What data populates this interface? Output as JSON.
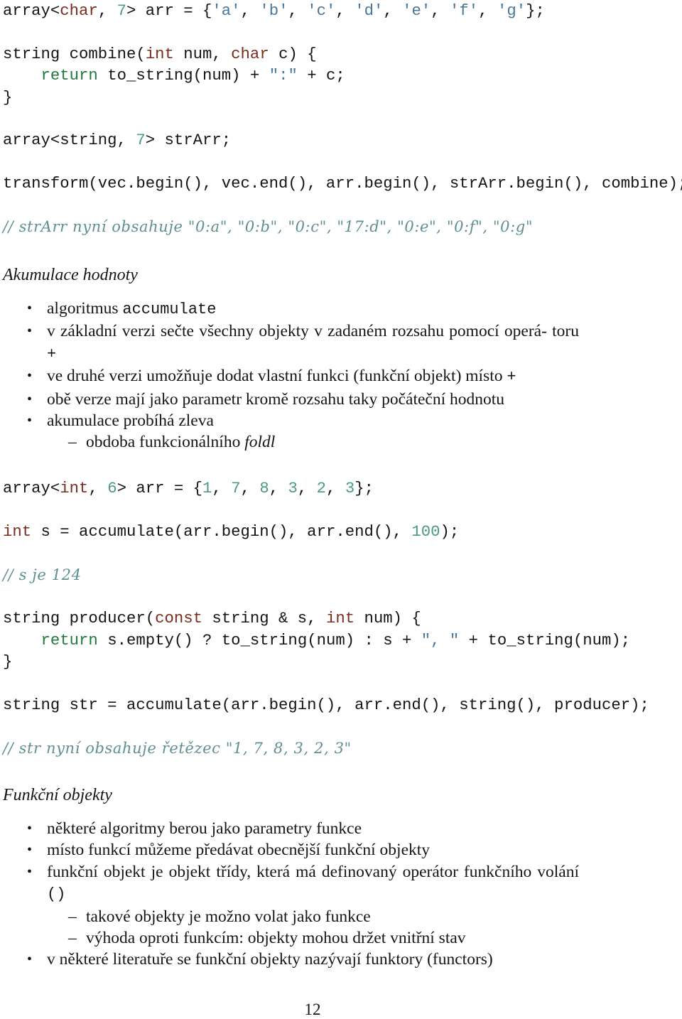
{
  "colors": {
    "type_keyword": "#7b2c1e",
    "return_keyword": "#1e7a3c",
    "number_literal": "#4c9a83",
    "string_literal": "#4a7798",
    "comment": "#5f8f90",
    "text": "#151515"
  },
  "code_block_1": {
    "line1": {
      "a": "array<",
      "t": "char",
      "b": ", ",
      "n": "7",
      "c": "> arr = {",
      "s1": "'a'",
      "s2": "'b'",
      "s3": "'c'",
      "s4": "'d'",
      "s5": "'e'",
      "s6": "'f'",
      "s7": "'g'",
      "sep": ", ",
      "end": "};"
    },
    "line2": {
      "a": "string combine(",
      "t1": "int",
      "b": " num, ",
      "t2": "char",
      "c": " c) {"
    },
    "line3": {
      "indent": "    ",
      "ret": "return",
      "a": " to_string(num) + ",
      "s": "\":\"",
      "b": " + c;"
    },
    "line4": "}",
    "line5": {
      "a": "array<string, ",
      "n": "7",
      "b": "> strArr;"
    },
    "line6": "transform(vec.begin(), vec.end(), arr.begin(), strArr.begin(), combine);",
    "comment": "// strArr nyní obsahuje \"0:a\", \"0:b\", \"0:c\", \"17:d\", \"0:e\", \"0:f\", \"0:g\""
  },
  "section_accumulate": {
    "heading": "Akumulace hodnoty",
    "items": [
      {
        "text": "algoritmus ",
        "code": "accumulate"
      },
      {
        "text": "v základní verzi sečte všechny objekty v zadaném rozsahu pomocí operá- toru ",
        "code": "+"
      },
      {
        "text": "ve druhé verzi umožňuje dodat vlastní funkci (funkční objekt) místo ",
        "code": "+"
      },
      {
        "text": "obě verze mají jako parametr kromě rozsahu taky počáteční hodnotu"
      },
      {
        "text": "akumulace probíhá zleva"
      }
    ],
    "subitem": {
      "text": "obdoba funkcionálního ",
      "italic": "foldl"
    }
  },
  "code_block_2": {
    "line1": {
      "a": "array<",
      "t": "int",
      "b": ", ",
      "n": "6",
      "c": "> arr = {",
      "v": [
        "1",
        "7",
        "8",
        "3",
        "2",
        "3"
      ],
      "sep": ", ",
      "end": "};"
    },
    "line2": {
      "t": "int",
      "a": " s = accumulate(arr.begin(), arr.end(), ",
      "n": "100",
      "b": ");"
    },
    "comment1": "// s je 124",
    "line3": {
      "a": "string producer(",
      "t1": "const",
      "b": " string & s, ",
      "t2": "int",
      "c": " num) {"
    },
    "line4": {
      "indent": "    ",
      "ret": "return",
      "a": " s.empty() ? to_string(num) : s + ",
      "s": "\", \"",
      "b": " + to_string(num);"
    },
    "line5": "}",
    "line6": "string str = accumulate(arr.begin(), arr.end(), string(), producer);",
    "comment2": "// str nyní obsahuje řetězec \"1, 7, 8, 3, 2, 3\""
  },
  "section_functors": {
    "heading": "Funkční objekty",
    "items": [
      {
        "text": "některé algoritmy berou jako parametry funkce"
      },
      {
        "text": "místo funkcí můžeme předávat obecnější funkční objekty"
      },
      {
        "text": "funkční objekt je objekt třídy, která má definovaný operátor funkčního volání ",
        "code": "()"
      }
    ],
    "subitems": [
      "takové objekty je možno volat jako funkce",
      "výhoda oproti funkcím: objekty mohou držet vnitřní stav"
    ],
    "last_item": "v některé literatuře se funkční objekty nazývají funktory (functors)"
  },
  "page_number": "12"
}
